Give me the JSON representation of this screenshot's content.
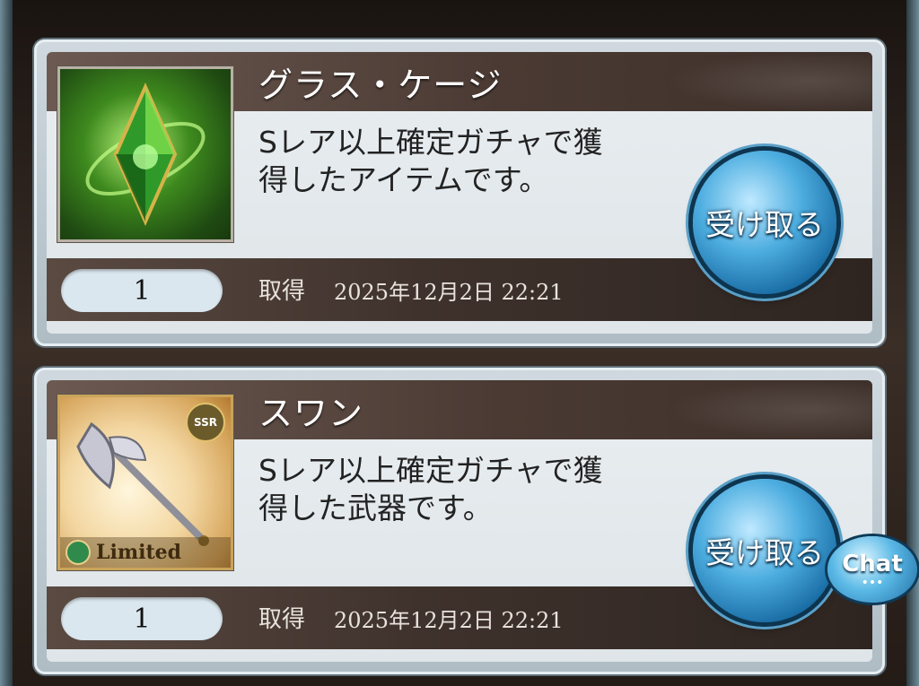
{
  "items": [
    {
      "name": "グラス・ケージ",
      "description_line1": "Sレア以上確定ガチャで獲",
      "description_line2": "得したアイテムです。",
      "quantity": "1",
      "obtained_label": "取得",
      "obtained_date": "2025年12月2日 22:21",
      "receive_label": "受け取る",
      "icon": "green-crystal-icon"
    },
    {
      "name": "スワン",
      "description_line1": "Sレア以上確定ガチャで獲",
      "description_line2": "得した武器です。",
      "quantity": "1",
      "obtained_label": "取得",
      "obtained_date": "2025年12月2日 22:21",
      "receive_label": "受け取る",
      "icon": "axe-weapon-icon",
      "rarity_badge": "SSR",
      "limited_label": "Limited"
    }
  ],
  "chat": {
    "label": "Chat",
    "dots": "•••"
  },
  "colors": {
    "button_blue": "#4eaee0",
    "band_brown": "#4a3a33"
  }
}
